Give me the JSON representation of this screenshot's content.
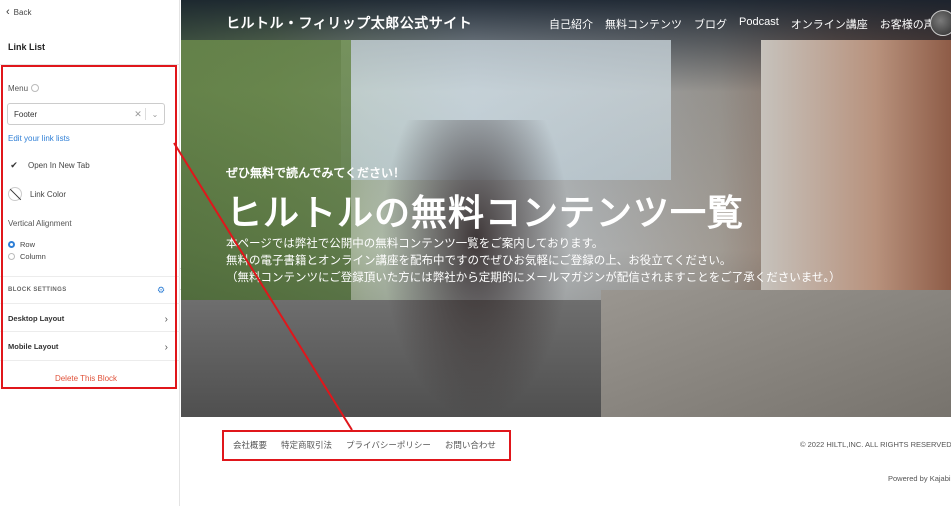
{
  "panel": {
    "back_label": "Back",
    "title": "Link List",
    "menu_label": "Menu",
    "menu_value": "Footer",
    "edit_link": "Edit your link lists",
    "open_new_tab": "Open In New Tab",
    "link_color": "Link Color",
    "vertical_alignment": "Vertical Alignment",
    "alignment_options": [
      "Row",
      "Column"
    ],
    "alignment_selected": "Row",
    "block_settings": "BLOCK SETTINGS",
    "desktop_layout": "Desktop Layout",
    "mobile_layout": "Mobile Layout",
    "delete": "Delete This Block"
  },
  "site": {
    "title": "ヒルトル・フィリップ太郎公式サイト",
    "menu": [
      "自己紹介",
      "無料コンテンツ",
      "ブログ",
      "Podcast",
      "オンライン講座",
      "お客様の声"
    ],
    "hero_sub": "ぜひ無料で読んでみてください！",
    "hero_title": "ヒルトルの無料コンテンツ一覧",
    "hero_desc": [
      "本ページでは弊社で公開中の無料コンテンツ一覧をご案内しております。",
      "無料の電子書籍とオンライン講座を配布中ですのでぜひお気軽にご登録の上、お役立てください。",
      "（無料コンテンツにご登録頂いた方には弊社から定期的にメールマガジンが配信されますことをご了承くださいませ。）"
    ],
    "footer_links": [
      "会社概要",
      "特定商取引法",
      "プライバシーポリシー",
      "お問い合わせ"
    ],
    "copyright": "© 2022 HILTL,INC. ALL RIGHTS RESERVED",
    "powered": "Powered by Kajabi"
  },
  "colors": {
    "annotation_red": "#e0161b",
    "link_blue": "#2f7fd6",
    "delete_red": "#e0533b"
  }
}
